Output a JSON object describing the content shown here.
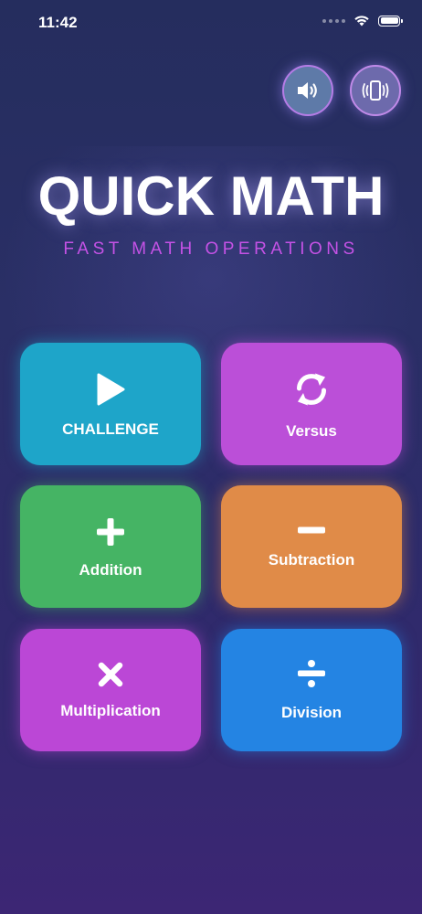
{
  "status_bar": {
    "time": "11:42"
  },
  "header_controls": {
    "sound_icon": "speaker-volume-icon",
    "vibrate_icon": "phone-vibrate-icon"
  },
  "title": "QUICK MATH",
  "subtitle": "FAST MATH OPERATIONS",
  "modes": [
    {
      "label": "CHALLENGE",
      "icon": "play-icon",
      "color": "#1ea5c9"
    },
    {
      "label": "Versus",
      "icon": "refresh-arrows-icon",
      "color": "#bb4fd8"
    },
    {
      "label": "Addition",
      "icon": "plus-icon",
      "color": "#45b464"
    },
    {
      "label": "Subtraction",
      "icon": "minus-icon",
      "color": "#e08b48"
    },
    {
      "label": "Multiplication",
      "icon": "multiply-icon",
      "color": "#bb47d6"
    },
    {
      "label": "Division",
      "icon": "divide-icon",
      "color": "#2484e3"
    }
  ],
  "colors": {
    "subtitle": "#c552e6",
    "background_top": "#252d5e",
    "background_bottom": "#3c2674"
  }
}
